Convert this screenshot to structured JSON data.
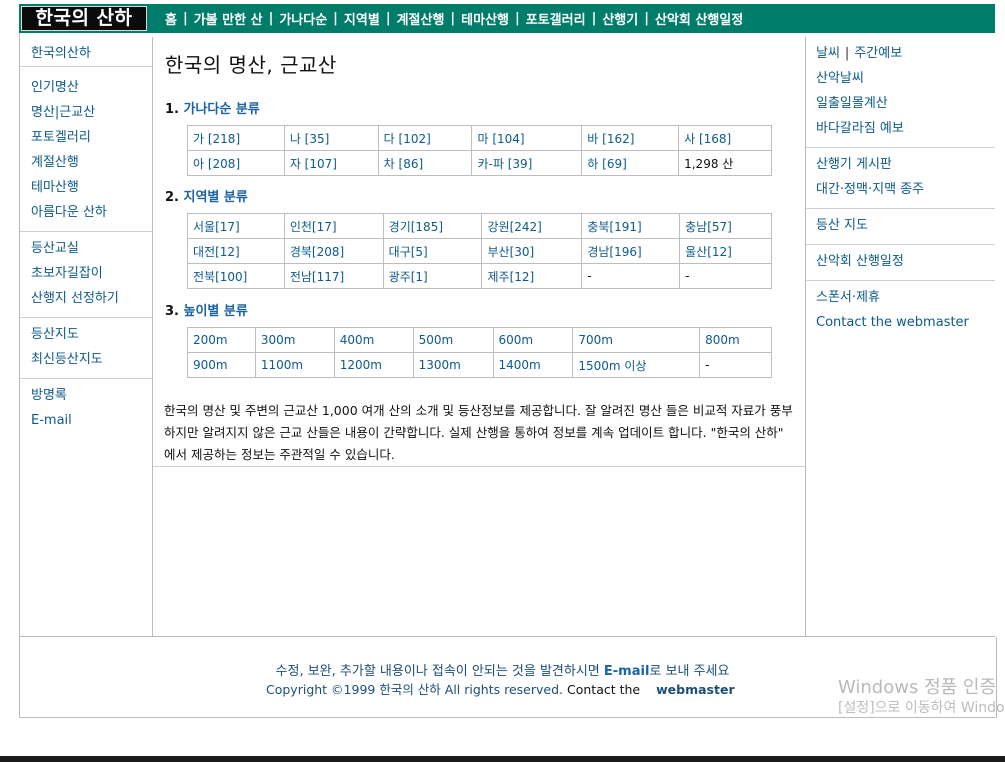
{
  "header": {
    "logo_text": "한국의 산하",
    "nav": [
      "홈",
      "가볼 만한 산",
      "가나다순",
      "지역별",
      "계절산행",
      "테마산행",
      "포토갤러리",
      "산행기",
      "산악회 산행일정"
    ]
  },
  "left_sidebar": {
    "groups": [
      [
        "한국의산하"
      ],
      [
        "인기명산",
        "명산|근교산",
        "포토겔러리",
        "계절산행",
        "테마산행",
        "아름다운 산하"
      ],
      [
        "등산교실",
        "초보자길잡이",
        "산행지 선정하기"
      ],
      [
        "등산지도",
        "최신등산지도"
      ],
      [
        "방명록",
        "E-mail"
      ]
    ]
  },
  "right_sidebar": {
    "weather": "날씨",
    "weekly": "주간예보",
    "groups": [
      [
        "산악날씨",
        "일출일몰계산",
        "바다갈라짐 예보"
      ],
      [
        "산행기 게시판",
        "대간·정맥·지맥 종주"
      ],
      [
        "등산 지도"
      ],
      [
        "산악회 산행일정"
      ],
      [
        "스폰서·제휴",
        "Contact the webmaster"
      ]
    ]
  },
  "main": {
    "title": "한국의 명산, 근교산",
    "sections": [
      {
        "num": "1.",
        "label": "가나다순 분류"
      },
      {
        "num": "2.",
        "label": "지역별 분류"
      },
      {
        "num": "3.",
        "label": "높이별 분류"
      }
    ],
    "alpha_table": [
      [
        "가 [218]",
        "나 [35]",
        "다 [102]",
        "마 [104]",
        "바 [162]",
        "사 [168]"
      ],
      [
        "아 [208]",
        "자 [107]",
        "차 [86]",
        "카-파 [39]",
        "하 [69]",
        "1,298 산"
      ]
    ],
    "region_table": [
      [
        "서울[17]",
        "인천[17]",
        "경기[185]",
        "강원[242]",
        "충북[191]",
        "충남[57]"
      ],
      [
        "대전[12]",
        "경북[208]",
        "대구[5]",
        "부산[30]",
        "경남[196]",
        "울산[12]"
      ],
      [
        "전북[100]",
        "전남[117]",
        "광주[1]",
        "제주[12]",
        "-",
        "-"
      ]
    ],
    "height_table": [
      [
        "200m",
        "300m",
        "400m",
        "500m",
        "600m",
        "700m",
        "800m"
      ],
      [
        "900m",
        "1100m",
        "1200m",
        "1300m",
        "1400m",
        "1500m 이상",
        "-"
      ]
    ],
    "description": "한국의 명산 및 주변의 근교산 1,000 여개 산의 소개 및 등산정보를 제공합니다. 잘 알려진 명산 들은 비교적 자료가 풍부하지만 알려지지 않은 근교 산들은 내용이 간략합니다. 실제 산행을 통하여 정보를 계속 업데이트 합니다. \"한국의 산하\" 에서 제공하는 정보는 주관적일 수 있습니다."
  },
  "footer": {
    "line1_prefix": "수정, 보완, 추가할 내용이나 접속이 안되는 것을 발견하시면 ",
    "line1_email": "E-mail",
    "line1_suffix": "로 보내 주세요",
    "copyright": "Copyright ©1999 한국의 산하 All rights reserved.",
    "contact": "Contact the",
    "webmaster": "webmaster"
  },
  "watermark": {
    "line1": "Windows 정품 인증",
    "line2": "[설정]으로 이동하여 Windows"
  }
}
